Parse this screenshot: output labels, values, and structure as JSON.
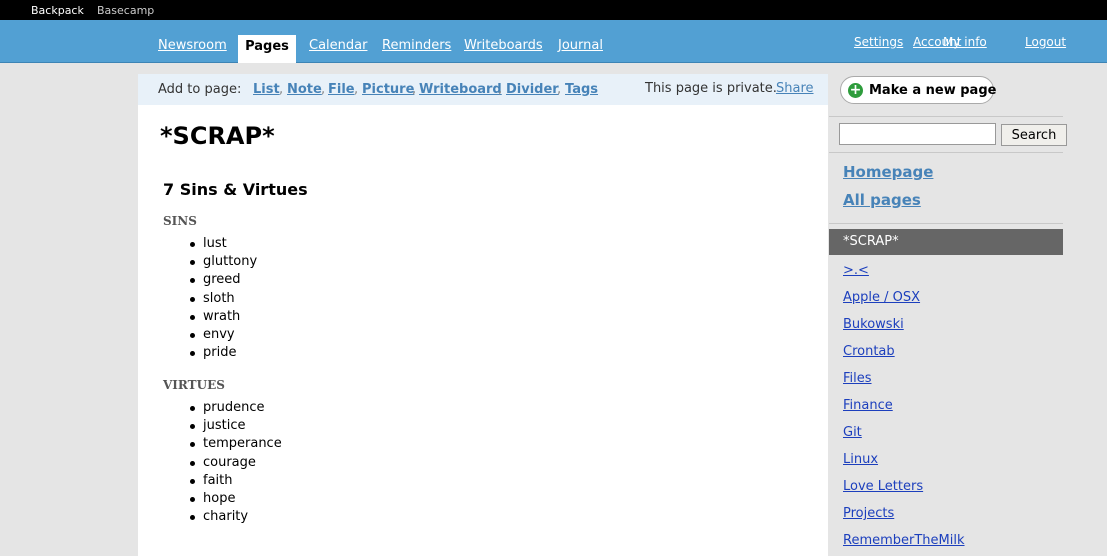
{
  "topbar": {
    "backpack": "Backpack",
    "basecamp": "Basecamp"
  },
  "nav": {
    "tabs": [
      "Newsroom",
      "Pages",
      "Calendar",
      "Reminders",
      "Writeboards",
      "Journal"
    ],
    "active_tab": "Pages",
    "account": [
      "Settings",
      "Account",
      "My info",
      "Logout"
    ]
  },
  "addbar": {
    "label": "Add to page:",
    "items": [
      "List",
      "Note",
      "File",
      "Picture",
      "Writeboard",
      "Divider",
      "Tags"
    ],
    "privacy_text": "This page is private.",
    "share_label": "Share"
  },
  "page": {
    "title": "*SCRAP*",
    "section_title": "7 Sins & Virtues",
    "sins_heading": "SINS",
    "sins": [
      "lust",
      "gluttony",
      "greed",
      "sloth",
      "wrath",
      "envy",
      "pride"
    ],
    "virtues_heading": "VIRTUES",
    "virtues": [
      "prudence",
      "justice",
      "temperance",
      "courage",
      "faith",
      "hope",
      "charity"
    ]
  },
  "sidebar": {
    "new_page_label": "Make a new page",
    "search_value": "",
    "search_button": "Search",
    "homepage_link": "Homepage",
    "all_pages_link": "All pages",
    "current_page": "*SCRAP*",
    "pages": [
      ">.<",
      "Apple / OSX",
      "Bukowski",
      "Crontab",
      "Files",
      "Finance",
      "Git",
      "Linux",
      "Love Letters",
      "Projects",
      "RememberTheMilk"
    ]
  }
}
